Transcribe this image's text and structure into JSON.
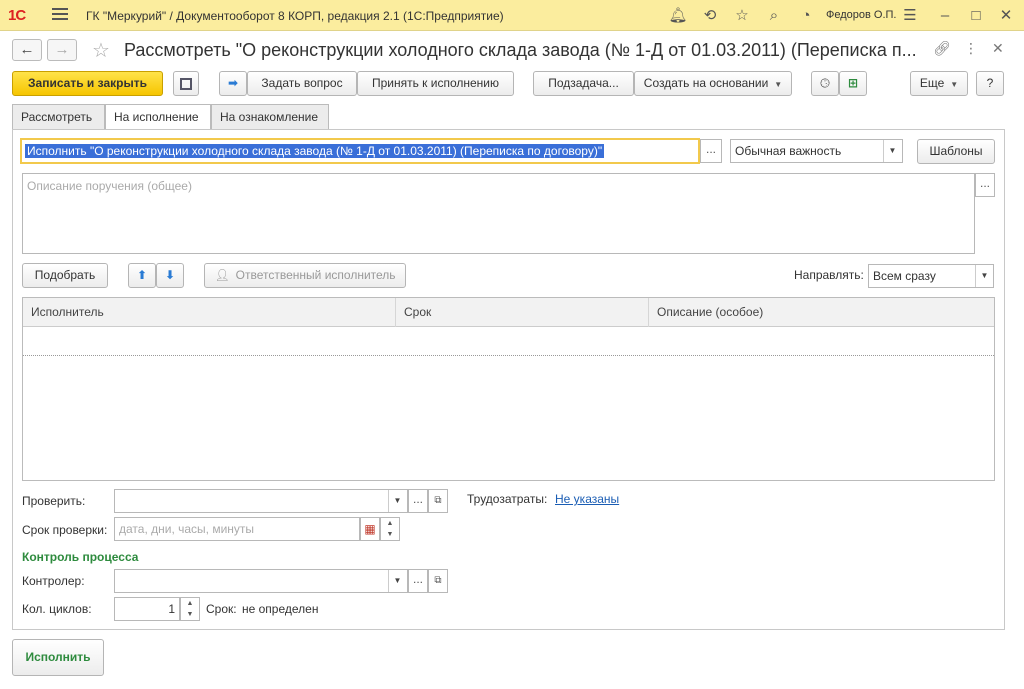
{
  "titlebar": {
    "logo": "1С",
    "app_title": "ГК \"Меркурий\" / Документооборот 8 КОРП, редакция 2.1  (1С:Предприятие)",
    "user": "Федоров О.П."
  },
  "header": {
    "title": "Рассмотреть \"О реконструкции холодного склада завода (№ 1-Д от 01.03.2011) (Переписка п..."
  },
  "toolbar": {
    "save_close": "Записать и закрыть",
    "ask_question": "Задать вопрос",
    "accept": "Принять к исполнению",
    "subtask": "Подзадача...",
    "create_based": "Создать на основании",
    "more": "Еще",
    "help": "?"
  },
  "tabs": [
    "Рассмотреть",
    "На исполнение",
    "На ознакомление"
  ],
  "form": {
    "task_name": "Исполнить \"О реконструкции холодного склада завода (№ 1-Д от 01.03.2011) (Переписка по договору)\"",
    "importance": "Обычная важность",
    "templates": "Шаблоны",
    "description_placeholder": "Описание поручения (общее)",
    "pick": "Подобрать",
    "responsible": "Ответственный исполнитель",
    "direct_label": "Направлять:",
    "direct_value": "Всем сразу",
    "columns": [
      "Исполнитель",
      "Срок",
      "Описание (особое)"
    ],
    "check_label": "Проверить:",
    "effort_label": "Трудозатраты:",
    "effort_value": "Не указаны",
    "check_deadline_label": "Срок проверки:",
    "check_deadline_placeholder": "дата, дни, часы, минуты",
    "process_control": "Контроль процесса",
    "controller_label": "Контролер:",
    "cycles_label": "Кол. циклов:",
    "cycles_value": "1",
    "term_label": "Срок:",
    "term_value": "не определен"
  },
  "footer": {
    "execute": "Исполнить"
  }
}
